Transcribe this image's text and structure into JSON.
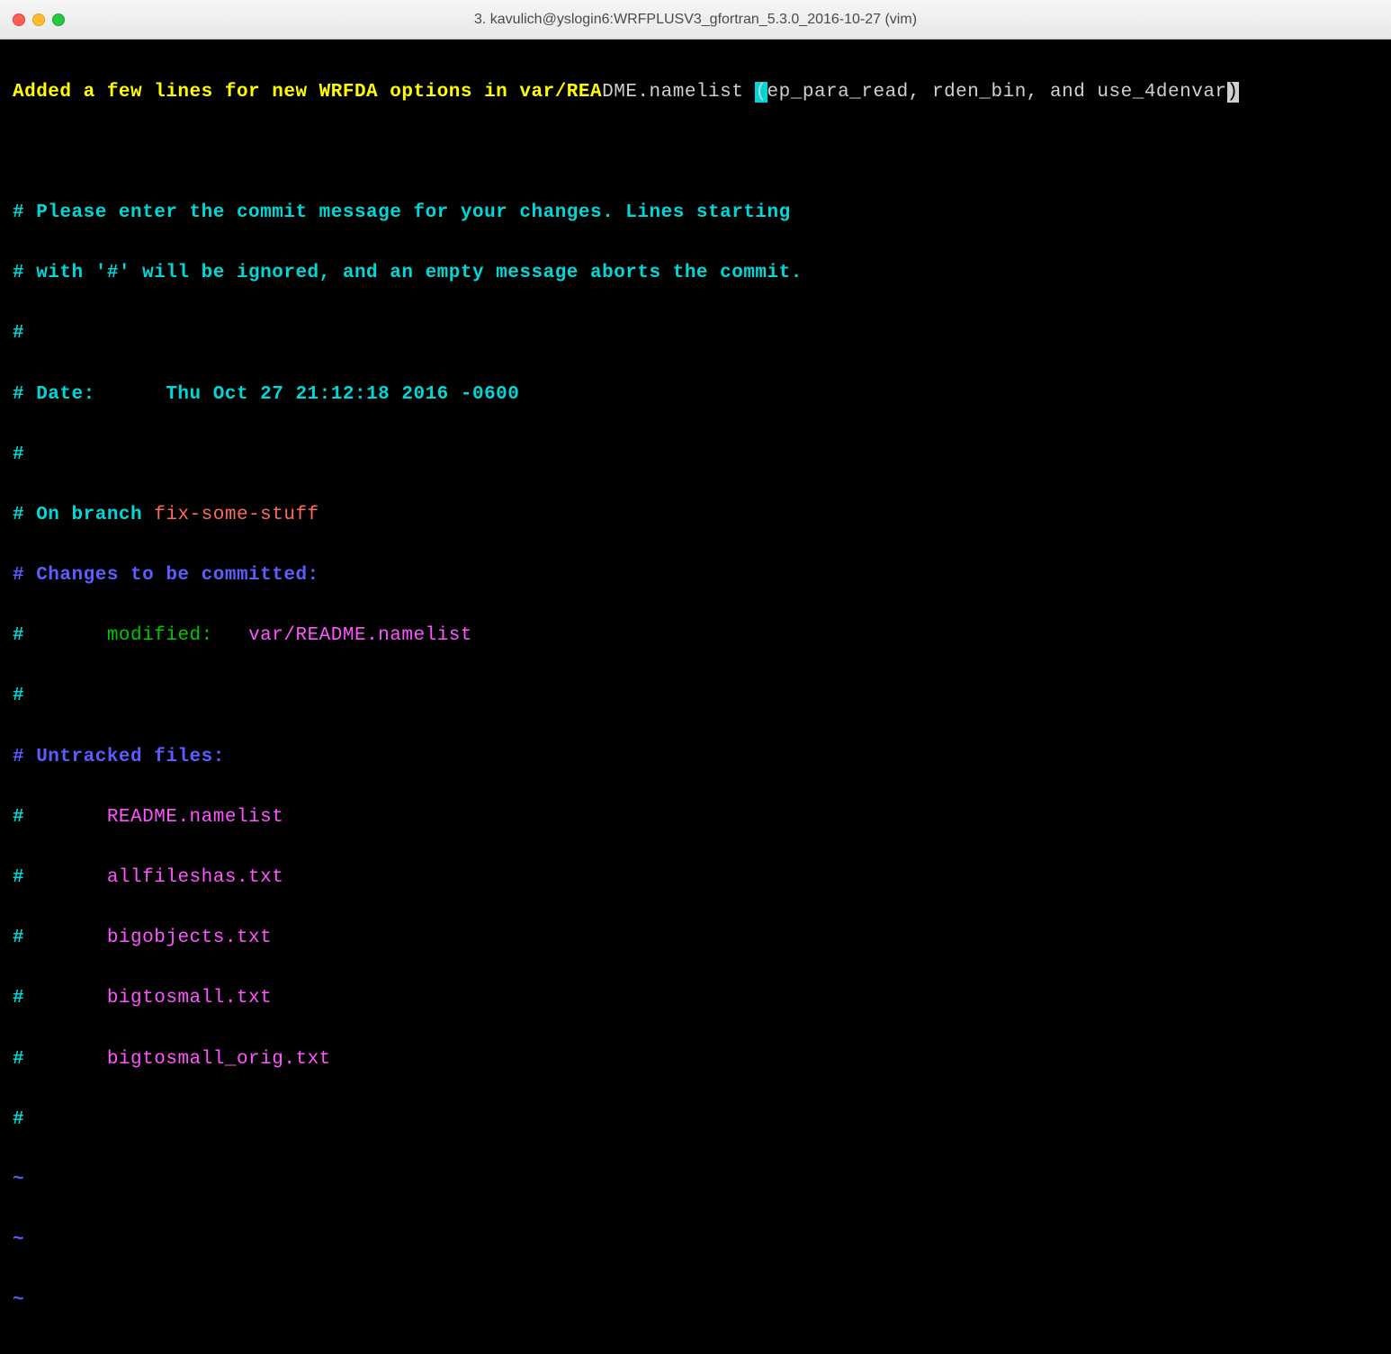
{
  "window": {
    "title": "3. kavulich@yslogin6:WRFPLUSV3_gfortran_5.3.0_2016-10-27 (vim)"
  },
  "line1": {
    "yellow": "Added a few lines for new WRFDA options in var/REA",
    "white1": "DME.namelist ",
    "paren_open": "(",
    "white2": "ep_para_read, rden_bin, and use_4denvar",
    "paren_close": ")"
  },
  "comments": {
    "hash": "#",
    "please1": "# Please enter the commit message for your changes. Lines starting",
    "please2": "# with '#' will be ignored, and an empty message aborts the commit.",
    "date_label": "# Date:      ",
    "date_value": "Thu Oct 27 21:12:18 2016 -0600",
    "onbranch": "# On branch ",
    "branch": "fix-some-stuff",
    "changes": "# Changes to be committed:",
    "modified_prefix": "#       ",
    "modified_label": "modified:   ",
    "modified_file": "var/README.namelist",
    "untracked": "# Untracked files:",
    "file_prefix": "#       ",
    "files": [
      "README.namelist",
      "allfileshas.txt",
      "bigobjects.txt",
      "bigtosmall.txt",
      "bigtosmall_orig.txt"
    ]
  },
  "tilde": "~"
}
